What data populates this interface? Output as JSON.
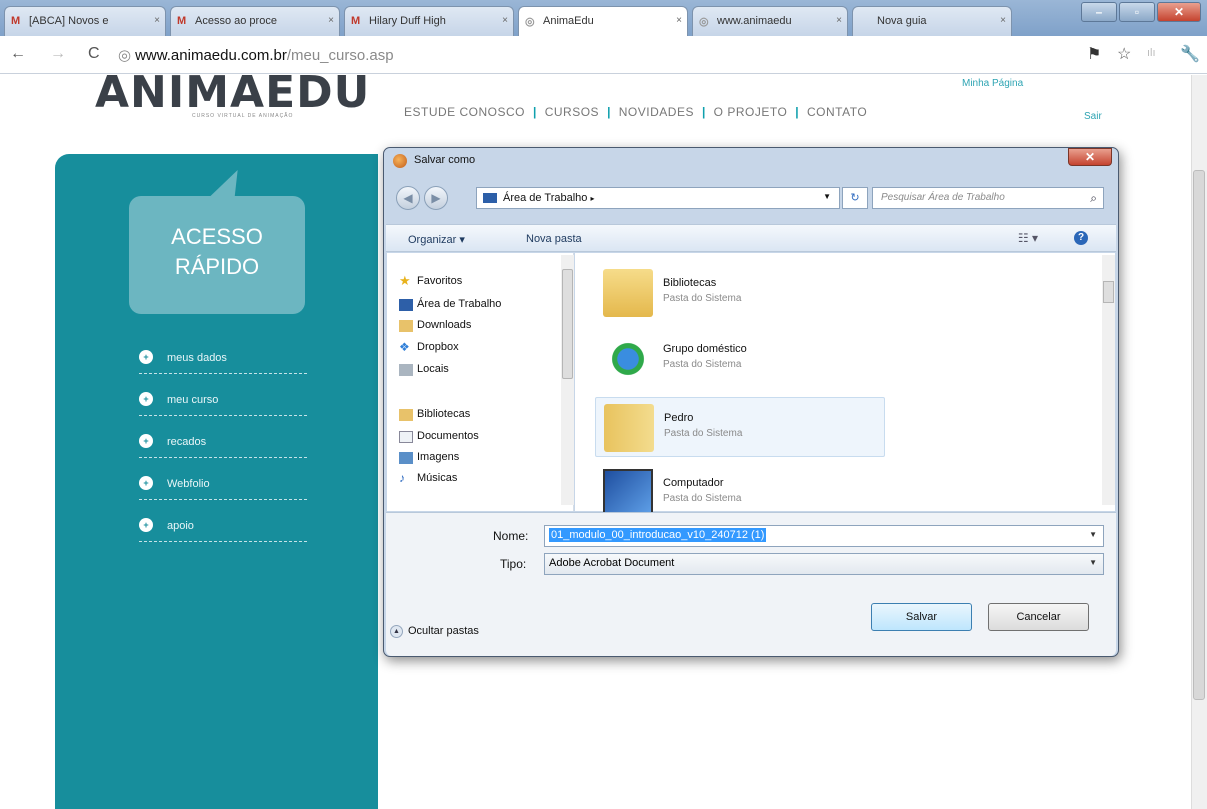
{
  "browser": {
    "tabs": [
      {
        "label": "[ABCA] Novos e",
        "icon": "M"
      },
      {
        "label": "Acesso ao proce",
        "icon": "M"
      },
      {
        "label": "Hilary Duff High",
        "icon": "M"
      },
      {
        "label": "AnimaEdu",
        "icon": "◎"
      },
      {
        "label": "www.animaedu",
        "icon": "◎"
      },
      {
        "label": "Nova guia",
        "icon": ""
      }
    ],
    "url_host": "www.animaedu.com.br",
    "url_path": "/meu_curso.asp"
  },
  "site": {
    "logo": "ANIMAEDU",
    "logo_tagline": "CURSO VIRTUAL DE ANIMAÇÃO",
    "nav": [
      "ESTUDE CONOSCO",
      "CURSOS",
      "NOVIDADES",
      "O PROJETO",
      "CONTATO"
    ],
    "minha_pagina": "Minha Página",
    "sair": "Sair",
    "quick_access": [
      "ACESSO",
      "RÁPIDO"
    ],
    "menu": [
      "meus dados",
      "meu curso",
      "recados",
      "Webfolio",
      "apoio"
    ],
    "accent": "#178e9c"
  },
  "dialog": {
    "title": "Salvar como",
    "breadcrumb": "Área de Trabalho",
    "search_placeholder": "Pesquisar Área de Trabalho",
    "organize": "Organizar ▾",
    "new_folder": "Nova pasta",
    "nav_pane": [
      "Favoritos",
      "Área de Trabalho",
      "Downloads",
      "Dropbox",
      "Locais",
      "Bibliotecas",
      "Documentos",
      "Imagens",
      "Músicas"
    ],
    "items": [
      {
        "name": "Bibliotecas",
        "desc": "Pasta do Sistema"
      },
      {
        "name": "Grupo doméstico",
        "desc": "Pasta do Sistema"
      },
      {
        "name": "Pedro",
        "desc": "Pasta do Sistema"
      },
      {
        "name": "Computador",
        "desc": "Pasta do Sistema"
      }
    ],
    "name_label": "Nome:",
    "name_value": "01_modulo_00_introducao_v10_240712 (1)",
    "type_label": "Tipo:",
    "type_value": "Adobe Acrobat Document",
    "hide_folders": "Ocultar pastas",
    "save": "Salvar",
    "cancel": "Cancelar"
  }
}
